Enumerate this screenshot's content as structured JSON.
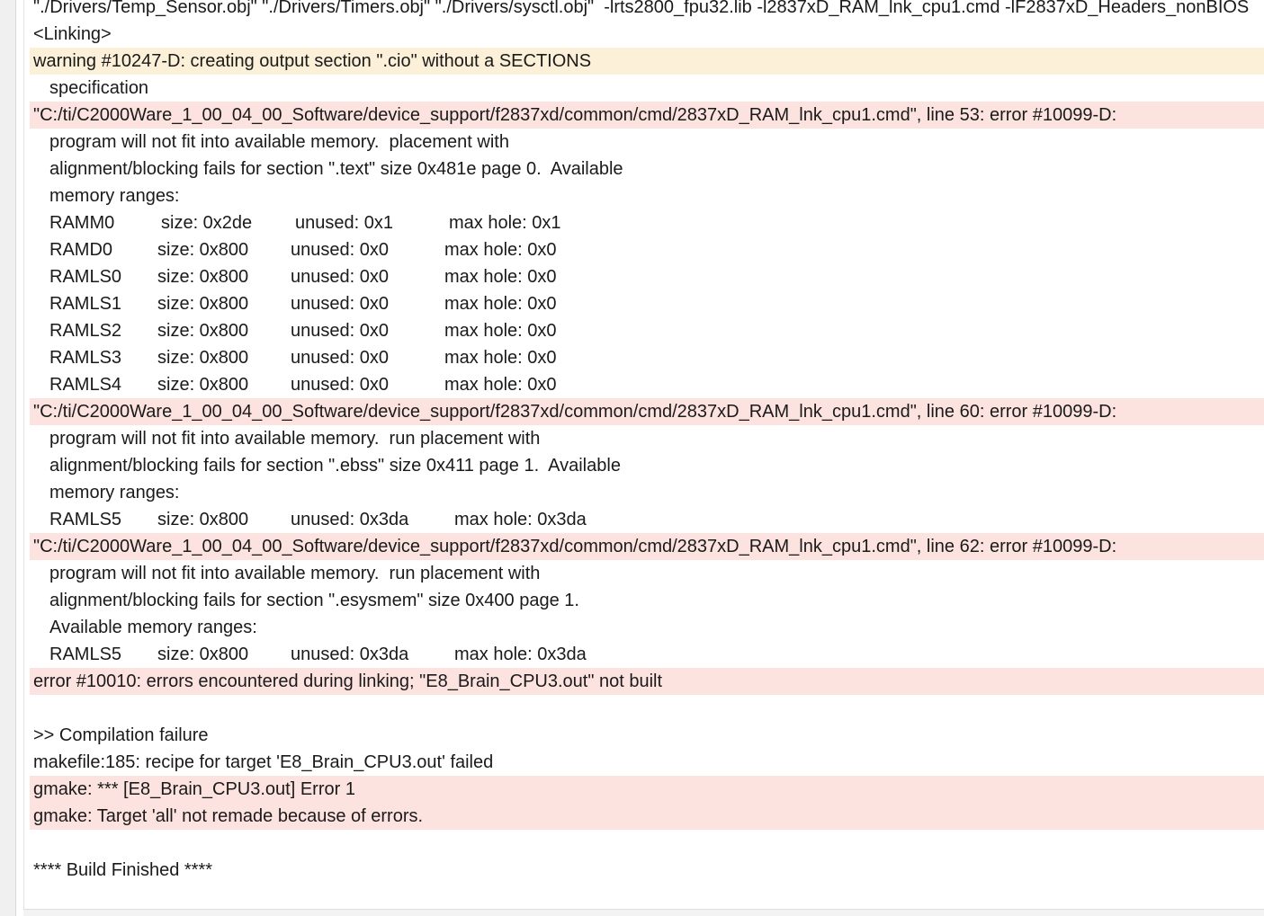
{
  "console": {
    "lines": [
      {
        "type": "plain",
        "text": "\"./Drivers/Temp_Sensor.obj\" \"./Drivers/Timers.obj\" \"./Drivers/sysctl.obj\"  -lrts2800_fpu32.lib -l2837xD_RAM_lnk_cpu1.cmd -lF2837xD_Headers_nonBIOS"
      },
      {
        "type": "plain",
        "text": "<Linking>"
      },
      {
        "type": "warning",
        "text": "warning #10247-D: creating output section \".cio\" without a SECTIONS"
      },
      {
        "type": "indent",
        "text": "specification"
      },
      {
        "type": "error",
        "text": "\"C:/ti/C2000Ware_1_00_04_00_Software/device_support/f2837xd/common/cmd/2837xD_RAM_lnk_cpu1.cmd\", line 53: error #10099-D:"
      },
      {
        "type": "indent",
        "text": "program will not fit into available memory.  placement with"
      },
      {
        "type": "indent",
        "text": "alignment/blocking fails for section \".text\" size 0x481e page 0.  Available"
      },
      {
        "type": "indent",
        "text": "memory ranges:"
      },
      {
        "type": "mem",
        "cls": "shift",
        "name": "RAMM0",
        "size": "size: 0x2de",
        "unused": "unused: 0x1",
        "maxhole": "max hole: 0x1"
      },
      {
        "type": "mem",
        "cls": "",
        "name": "RAMD0",
        "size": "size: 0x800",
        "unused": "unused: 0x0",
        "maxhole": "max hole: 0x0"
      },
      {
        "type": "mem",
        "cls": "",
        "name": "RAMLS0",
        "size": "size: 0x800",
        "unused": "unused: 0x0",
        "maxhole": "max hole: 0x0"
      },
      {
        "type": "mem",
        "cls": "",
        "name": "RAMLS1",
        "size": "size: 0x800",
        "unused": "unused: 0x0",
        "maxhole": "max hole: 0x0"
      },
      {
        "type": "mem",
        "cls": "",
        "name": "RAMLS2",
        "size": "size: 0x800",
        "unused": "unused: 0x0",
        "maxhole": "max hole: 0x0"
      },
      {
        "type": "mem",
        "cls": "",
        "name": "RAMLS3",
        "size": "size: 0x800",
        "unused": "unused: 0x0",
        "maxhole": "max hole: 0x0"
      },
      {
        "type": "mem",
        "cls": "",
        "name": "RAMLS4",
        "size": "size: 0x800",
        "unused": "unused: 0x0",
        "maxhole": "max hole: 0x0"
      },
      {
        "type": "error",
        "text": "\"C:/ti/C2000Ware_1_00_04_00_Software/device_support/f2837xd/common/cmd/2837xD_RAM_lnk_cpu1.cmd\", line 60: error #10099-D:"
      },
      {
        "type": "indent",
        "text": "program will not fit into available memory.  run placement with"
      },
      {
        "type": "indent",
        "text": "alignment/blocking fails for section \".ebss\" size 0x411 page 1.  Available"
      },
      {
        "type": "indent",
        "text": "memory ranges:"
      },
      {
        "type": "mem",
        "cls": "wide",
        "name": "RAMLS5",
        "size": "size: 0x800",
        "unused": "unused: 0x3da",
        "maxhole": "max hole: 0x3da"
      },
      {
        "type": "error",
        "text": "\"C:/ti/C2000Ware_1_00_04_00_Software/device_support/f2837xd/common/cmd/2837xD_RAM_lnk_cpu1.cmd\", line 62: error #10099-D:"
      },
      {
        "type": "indent",
        "text": "program will not fit into available memory.  run placement with"
      },
      {
        "type": "indent",
        "text": "alignment/blocking fails for section \".esysmem\" size 0x400 page 1."
      },
      {
        "type": "indent",
        "text": "Available memory ranges:"
      },
      {
        "type": "mem",
        "cls": "wide",
        "name": "RAMLS5",
        "size": "size: 0x800",
        "unused": "unused: 0x3da",
        "maxhole": "max hole: 0x3da"
      },
      {
        "type": "error",
        "text": "error #10010: errors encountered during linking; \"E8_Brain_CPU3.out\" not built"
      },
      {
        "type": "plain",
        "text": ""
      },
      {
        "type": "plain",
        "text": ">> Compilation failure"
      },
      {
        "type": "plain",
        "text": "makefile:185: recipe for target 'E8_Brain_CPU3.out' failed"
      },
      {
        "type": "error",
        "text": "gmake: *** [E8_Brain_CPU3.out] Error 1"
      },
      {
        "type": "error",
        "text": "gmake: Target 'all' not remade because of errors."
      },
      {
        "type": "plain",
        "text": ""
      },
      {
        "type": "plain",
        "text": "**** Build Finished ****"
      }
    ]
  }
}
